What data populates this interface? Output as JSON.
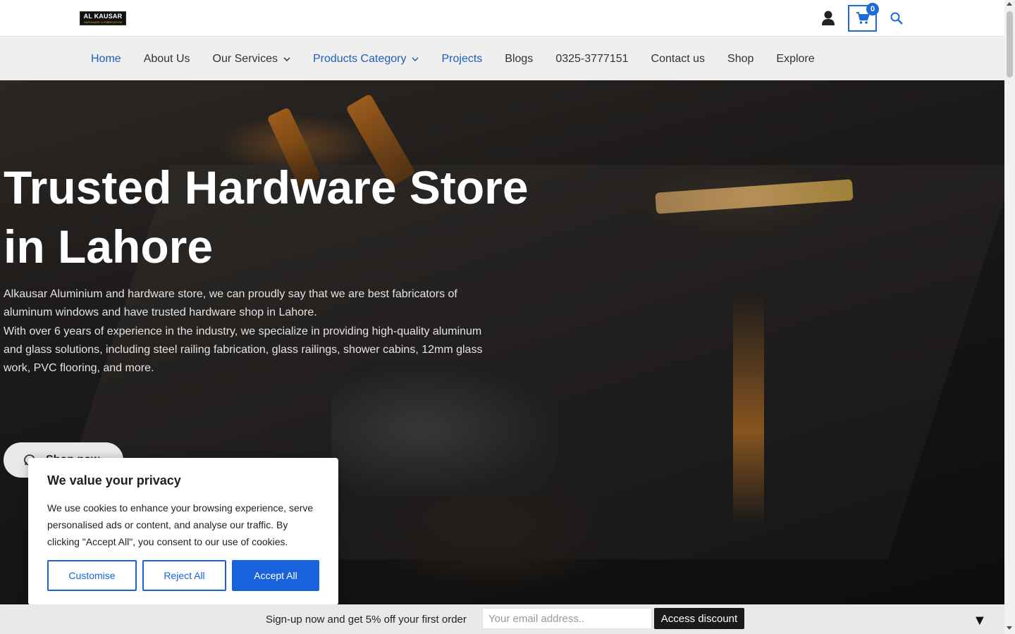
{
  "header": {
    "logo_text": "AL KAUSAR",
    "logo_subtext": "HARDWARE & FABRICATION",
    "account_icon": "user-icon",
    "cart_icon": "shopping-cart-icon",
    "cart_count": "0",
    "search_icon": "search-icon",
    "accent_color": "#1e6ad6"
  },
  "nav": {
    "items": [
      {
        "label": "Home",
        "active": true
      },
      {
        "label": "About Us"
      },
      {
        "label": "Our Services",
        "dropdown": true
      },
      {
        "label": "Products Category",
        "dropdown": true,
        "active": true
      },
      {
        "label": "Projects",
        "active": true
      },
      {
        "label": "Blogs"
      },
      {
        "label": "0325-3777151"
      },
      {
        "label": "Contact us"
      },
      {
        "label": "Shop"
      },
      {
        "label": "Explore"
      }
    ]
  },
  "hero": {
    "title": "Trusted Hardware Store in Lahore",
    "paragraph1": "Alkausar Aluminium and hardware store, we can proudly say that we are best fabricators of aluminum windows and have trusted hardware shop in Lahore.",
    "paragraph2": "With over 6 years of experience in the industry, we specialize in providing high-quality aluminum and glass solutions, including steel railing fabrication, glass railings, shower cabins, 12mm glass work, PVC flooring, and more.",
    "button_label": "Shop now",
    "button_icon": "whatsapp-icon"
  },
  "cookie_banner": {
    "title": "We value your privacy",
    "text": "We use cookies to enhance your browsing experience, serve personalised ads or content, and analyse our traffic. By clicking \"Accept All\", you consent to our use of cookies.",
    "customise_label": "Customise",
    "reject_label": "Reject All",
    "accept_label": "Accept All",
    "button_color": "#1863dc"
  },
  "signup_bar": {
    "message": "Sign-up now and get 5% off your first order",
    "email_placeholder": "Your email address..",
    "button_label": "Access discount",
    "collapse_glyph": "▼"
  }
}
